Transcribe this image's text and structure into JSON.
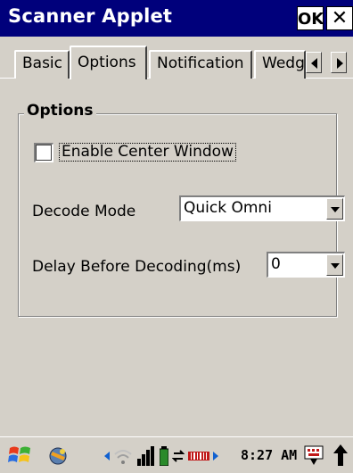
{
  "window": {
    "title": "Scanner Applet",
    "ok_label": "OK",
    "close_label": "✕"
  },
  "tabs": [
    {
      "label": "Basic",
      "active": false
    },
    {
      "label": "Options",
      "active": true
    },
    {
      "label": "Notification",
      "active": false
    },
    {
      "label": "Wedg",
      "active": false
    }
  ],
  "options": {
    "group_title": "Options",
    "enable_center_window": {
      "label": "Enable Center Window",
      "checked": false
    },
    "decode_mode": {
      "label": "Decode Mode",
      "value": "Quick Omni"
    },
    "delay_before_decoding": {
      "label": "Delay Before Decoding(ms)",
      "value": "0"
    }
  },
  "taskbar": {
    "clock": "8:27 AM",
    "icons": [
      "windows-start-icon",
      "scanner-app-icon",
      "wifi-icon",
      "signal-bars-icon",
      "battery-icon",
      "sync-icon",
      "barcode-icon",
      "keyboard-icon",
      "up-arrow-icon"
    ]
  },
  "colors": {
    "titlebar": "#00007b",
    "window_bg": "#d4d0c8"
  }
}
